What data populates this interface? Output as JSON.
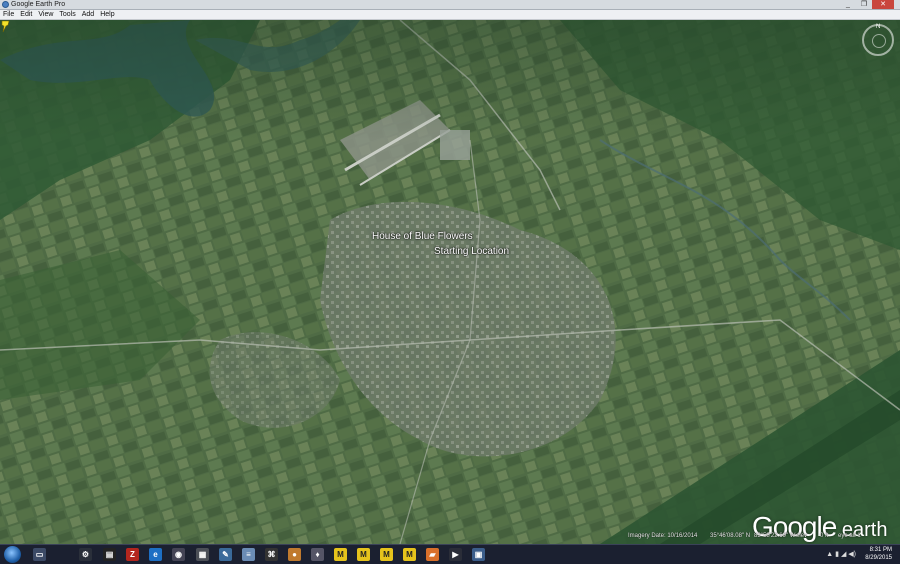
{
  "window": {
    "title": "Google Earth Pro",
    "min": "_",
    "max": "❐",
    "close": "✕"
  },
  "menu": [
    "File",
    "Edit",
    "View",
    "Tools",
    "Add",
    "Help"
  ],
  "map": {
    "placemarks": [
      {
        "label": "House of Blue Flowers"
      },
      {
        "label": "Starting Location"
      }
    ],
    "logo": {
      "main": "Google",
      "sub": " earth"
    },
    "compass": {
      "north": "N"
    }
  },
  "status": {
    "imagery": "Imagery Date: 10/16/2014",
    "lat": "35°46'08.08\" N",
    "lon": "83°58'22.69\" W",
    "elev": "elev",
    "eye": "0 ft",
    "eye_alt": "eye alt 1"
  },
  "taskbar": {
    "icons": [
      "window-icon",
      "settings-icon",
      "film-icon",
      "filezilla-icon",
      "ie-icon",
      "earth-icon",
      "calculator-icon",
      "paint-icon",
      "notepad-icon",
      "pdf-icon",
      "media-icon",
      "game-icon",
      "pacman-icon",
      "m-icon",
      "m-icon",
      "m-icon",
      "m-icon",
      "folder-icon",
      "player-icon",
      "photo-icon"
    ],
    "time": "8:31 PM",
    "date": "8/29/2015"
  }
}
